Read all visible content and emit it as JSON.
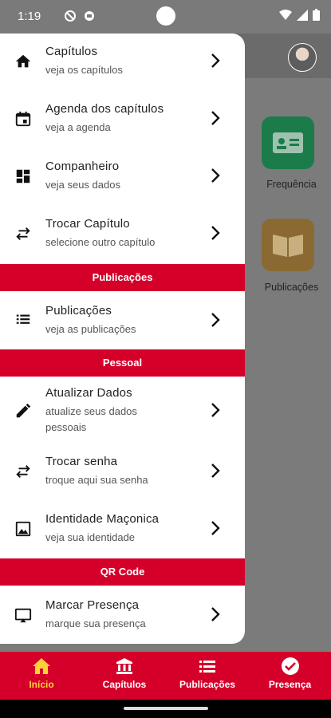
{
  "status_bar": {
    "time": "1:19"
  },
  "background": {
    "tiles": [
      {
        "label": "Frequência",
        "icon": "id-card-icon",
        "color": "#1c7b4a"
      },
      {
        "label": "Publicações",
        "icon": "book-open-icon",
        "color": "#8a6a32"
      }
    ]
  },
  "drawer": {
    "items": [
      {
        "title": "Capítulos",
        "subtitle": "veja os capítulos",
        "icon": "home-icon"
      },
      {
        "title": "Agenda dos capítulos",
        "subtitle": "veja a agenda",
        "icon": "calendar-icon"
      },
      {
        "title": "Companheiro",
        "subtitle": "veja seus dados",
        "icon": "dashboard-icon"
      },
      {
        "title": "Trocar Capítulo",
        "subtitle": "selecione outro capítulo",
        "icon": "swap-icon"
      }
    ],
    "section_publicacoes": "Publicações",
    "publicacoes_item": {
      "title": "Publicações",
      "subtitle": "veja as publicações",
      "icon": "list-icon"
    },
    "section_pessoal": "Pessoal",
    "pessoal_items": [
      {
        "title": "Atualizar Dados",
        "subtitle_line1": "atualize seus dados",
        "subtitle_line2": "pessoais",
        "icon": "edit-icon"
      },
      {
        "title": "Trocar senha",
        "subtitle": "troque aqui sua senha",
        "icon": "swap-icon"
      },
      {
        "title": "Identidade Maçonica",
        "subtitle": "veja sua identidade",
        "icon": "image-icon"
      }
    ],
    "section_qr": "QR Code",
    "qr_item": {
      "title": "Marcar Presença",
      "subtitle": "marque sua presença",
      "icon": "cast-icon"
    }
  },
  "bottom_nav": {
    "items": [
      {
        "label": "Início",
        "icon": "home-icon",
        "active": true
      },
      {
        "label": "Capítulos",
        "icon": "bank-icon"
      },
      {
        "label": "Publicações",
        "icon": "list-icon"
      },
      {
        "label": "Presença",
        "icon": "check-circle-icon"
      }
    ],
    "active_color": "#ffd23a",
    "bar_color": "#d4002a"
  }
}
